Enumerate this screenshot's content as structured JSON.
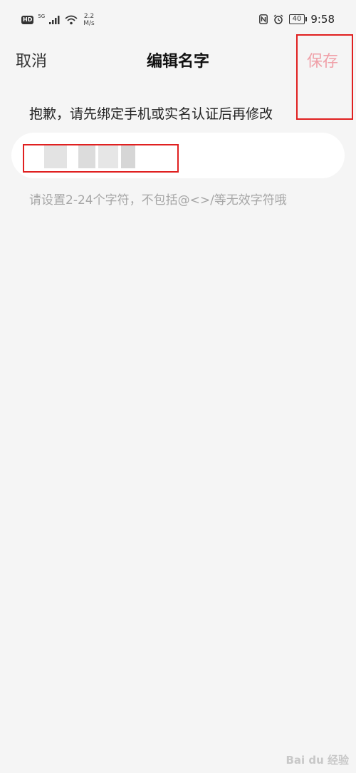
{
  "status_bar": {
    "hd": "HD",
    "signal": "5G",
    "speed_value": "2.2",
    "speed_unit": "M/s",
    "battery": "40",
    "time": "9:58"
  },
  "nav": {
    "cancel": "取消",
    "title": "编辑名字",
    "save": "保存"
  },
  "notice": "抱歉，请先绑定手机或实名认证后再修改",
  "hint": "请设置2-24个字符，不包括@<>/等无效字符哦",
  "watermark": "Bai du 经验",
  "colors": {
    "background": "#f5f5f5",
    "save_disabled": "#f0a0a8",
    "highlight": "#e02020",
    "hint": "#a6a6a6"
  }
}
